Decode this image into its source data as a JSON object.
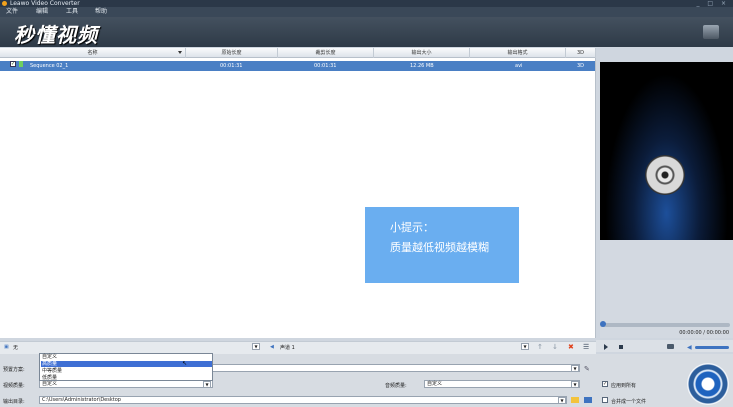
{
  "window": {
    "title": "Leawo Video Converter",
    "controls": "_ □ ×"
  },
  "menu": {
    "items": [
      "文件",
      "编辑",
      "工具",
      "帮助"
    ]
  },
  "watermark": "秒懂视频",
  "table": {
    "headers": [
      "名称",
      "原始长度",
      "裁剪长度",
      "输出大小",
      "输出格式",
      "3D"
    ],
    "rows": [
      {
        "checked": true,
        "name": "Sequence 02_1",
        "original_length": "00:01:31",
        "trimmed_length": "00:01:31",
        "output_size": "12.26 MB",
        "output_format": "avi",
        "threed": "3D"
      }
    ]
  },
  "hint": {
    "line1": "小提示：",
    "line2": "质量越低视频越模糊"
  },
  "player": {
    "timecode": "00:00:00 / 00:00:00"
  },
  "strip": {
    "subtitle": "无",
    "audio_track": "声道 1"
  },
  "bottom": {
    "preset_label": "预置方案:",
    "video_quality_label": "视频质量:",
    "video_quality_value": "自定义",
    "audio_quality_label": "音频质量:",
    "audio_quality_value": "自定义",
    "output_dir_label": "输出目录:",
    "output_dir_value": "C:\\Users\\Administrator\\Desktop",
    "apply_all_label": "应用到所有",
    "merge_label": "合并成一个文件"
  },
  "popup": {
    "options": [
      "自定义",
      "高质量",
      "中等质量",
      "低质量"
    ],
    "selected_index": 1
  }
}
